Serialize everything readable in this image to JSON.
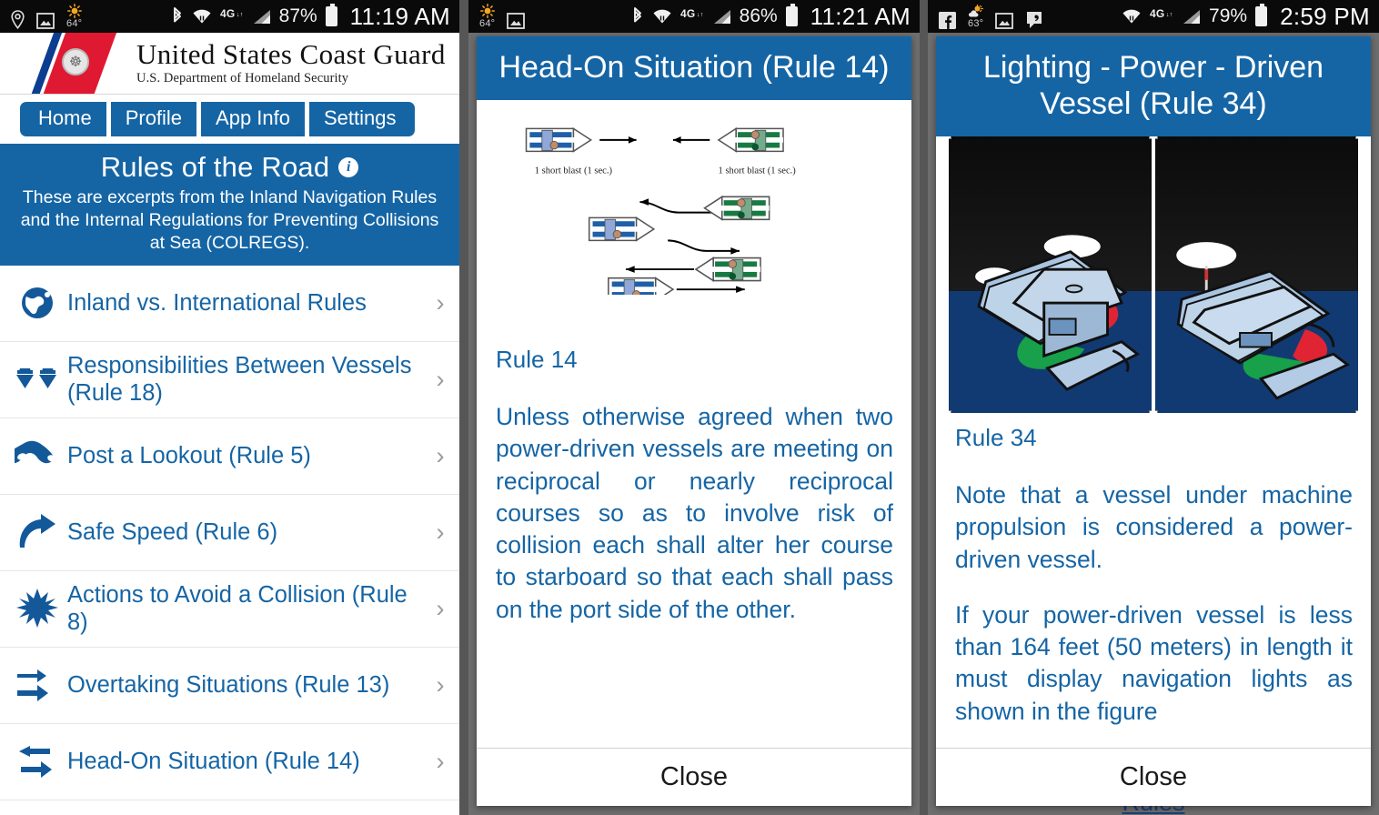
{
  "screens": [
    {
      "status_bar": {
        "icons": [
          "location-icon",
          "picture-icon",
          "weather-sun-icon"
        ],
        "temperature": "64°",
        "right_icons": [
          "bluetooth-icon",
          "wifi-icon",
          "lte-4g-icon",
          "signal-bars-icon"
        ],
        "battery_percent": "87%",
        "time": "11:19 AM"
      },
      "brand": {
        "line1": "United States Coast Guard",
        "line2": "U.S. Department of Homeland Security"
      },
      "nav_tabs": [
        {
          "label": "Home"
        },
        {
          "label": "Profile"
        },
        {
          "label": "App Info"
        },
        {
          "label": "Settings"
        }
      ],
      "section": {
        "title": "Rules of the Road",
        "info_icon": "info-icon",
        "description": "These are excerpts from the Inland Navigation Rules and the Internal Regulations for Preventing Collisions at Sea (COLREGS)."
      },
      "list": [
        {
          "icon": "globe-icon",
          "label": "Inland vs. International Rules",
          "chevron": "›"
        },
        {
          "icon": "two-vessels-icon",
          "label": "Responsibilities Between Vessels (Rule 18)",
          "chevron": "›"
        },
        {
          "icon": "binoculars-icon",
          "label": "Post a Lookout (Rule 5)",
          "chevron": "›"
        },
        {
          "icon": "curved-arrow-icon",
          "label": "Safe Speed (Rule 6)",
          "chevron": "›"
        },
        {
          "icon": "collision-burst-icon",
          "label": "Actions to Avoid a Collision (Rule 8)",
          "chevron": "›"
        },
        {
          "icon": "two-right-arrows-icon",
          "label": "Overtaking Situations (Rule 13)",
          "chevron": "›"
        },
        {
          "icon": "opposing-arrows-icon",
          "label": "Head-On Situation (Rule 14)",
          "chevron": "›"
        }
      ]
    },
    {
      "status_bar": {
        "icons": [
          "weather-sun-icon",
          "picture-icon"
        ],
        "temperature": "64°",
        "right_icons": [
          "bluetooth-icon",
          "wifi-icon",
          "lte-4g-icon",
          "signal-bars-icon"
        ],
        "battery_percent": "86%",
        "time": "11:21 AM"
      },
      "dialog": {
        "title": "Head-On Situation (Rule 14)",
        "figure": {
          "caption_left": "1 short blast (1 sec.)",
          "caption_right": "1 short blast (1 sec.)"
        },
        "heading": "Rule 14",
        "paragraphs": [
          "Unless otherwise agreed when two power-driven vessels are meeting on reciprocal or nearly reciprocal courses so as to involve risk of collision each shall alter her course to starboard so that each shall pass on the port side of the other."
        ],
        "close_label": "Close"
      }
    },
    {
      "status_bar": {
        "icons": [
          "facebook-icon",
          "weather-partly-cloudy-icon",
          "picture-icon",
          "hangouts-icon"
        ],
        "temperature": "63°",
        "right_icons": [
          "wifi-icon",
          "lte-4g-icon",
          "signal-bars-icon"
        ],
        "battery_percent": "79%",
        "time": "2:59 PM"
      },
      "dialog": {
        "title": "Lighting - Power - Driven Vessel (Rule 34)",
        "heading": "Rule 34",
        "paragraphs": [
          "Note that a vessel under machine propulsion is considered a power-driven vessel.",
          "If your power-driven vessel is less than 164 feet (50 meters) in length it must display navigation lights as shown in the figure"
        ],
        "close_label": "Close",
        "behind_link": "Rules"
      }
    }
  ],
  "colors": {
    "brand_blue": "#1565a5",
    "text_blue": "#1565a5",
    "status_bar": "#0a0a0a",
    "scrim": "#6e6e6e",
    "chevron": "#9a9a9a",
    "cg_red": "#e01933",
    "cg_navy": "#0b3d91"
  }
}
